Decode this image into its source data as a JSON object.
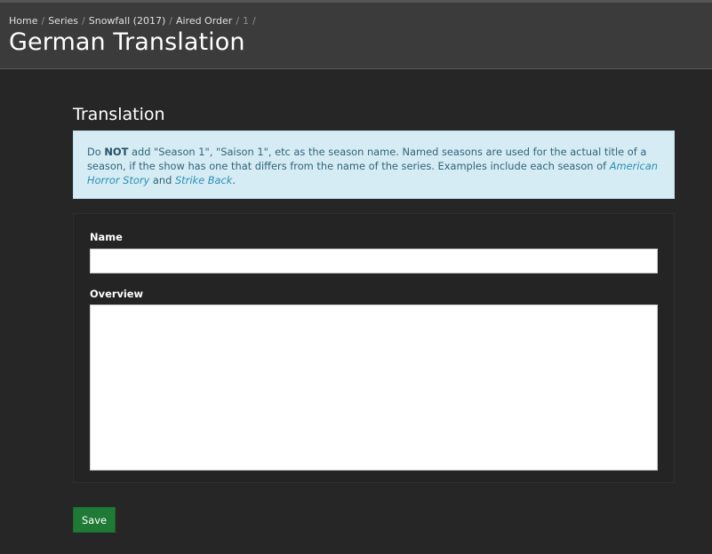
{
  "header": {
    "breadcrumb": [
      {
        "label": "Home"
      },
      {
        "label": "Series"
      },
      {
        "label": "Snowfall (2017)"
      },
      {
        "label": "Aired Order"
      }
    ],
    "breadcrumb_current": "1",
    "separator": "/",
    "title": "German Translation"
  },
  "main": {
    "section_title": "Translation",
    "alert": {
      "part1": "Do ",
      "bold": "NOT",
      "part2": " add \"Season 1\", \"Saison 1\", etc as the season name. Named seasons are used for the actual title of a season, if the show has one that differs from the name of the series. Examples include each season of ",
      "italic1": "American Horror Story",
      "part3": " and ",
      "italic2": "Strike Back",
      "part4": "."
    },
    "form": {
      "name_label": "Name",
      "name_value": "",
      "overview_label": "Overview",
      "overview_value": ""
    },
    "save_label": "Save"
  },
  "colors": {
    "page_bg": "#262626",
    "header_bg": "#3b3b3b",
    "alert_bg": "#d6ecf5",
    "alert_text": "#2f6478",
    "link": "#2a8fb2",
    "save_button": "#1f7a35"
  }
}
